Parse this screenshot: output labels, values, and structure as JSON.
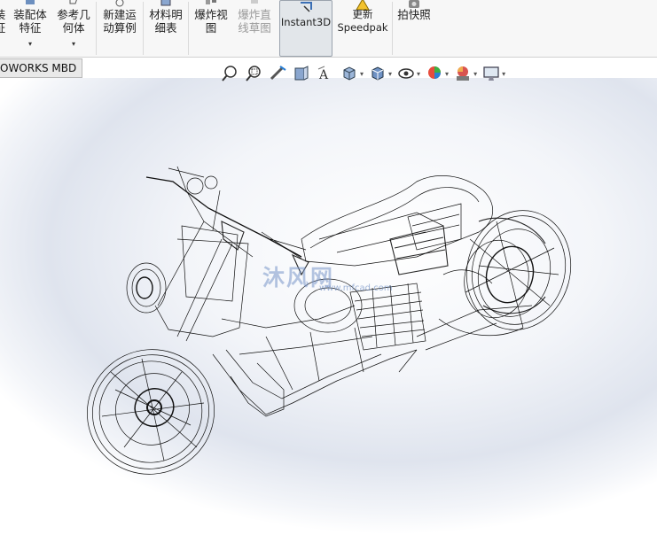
{
  "ribbon": {
    "buttons": [
      {
        "label": "装配体\n特征",
        "disabled": false,
        "icon": "assembly-features-icon"
      },
      {
        "label": "参考几\n何体",
        "disabled": false,
        "icon": "reference-geometry-icon"
      },
      {
        "label": "新建运\n动算例",
        "disabled": false,
        "icon": "new-motion-study-icon"
      },
      {
        "label": "材料明\n细表",
        "disabled": false,
        "icon": "bill-of-materials-icon"
      },
      {
        "label": "爆炸视\n图",
        "disabled": false,
        "icon": "exploded-view-icon"
      },
      {
        "label": "爆炸直\n线草图",
        "disabled": true,
        "icon": "explode-line-sketch-icon"
      },
      {
        "label": "Instant3D",
        "disabled": false,
        "active": true,
        "icon": "instant3d-icon"
      },
      {
        "label": "更新\nSpeedpak",
        "disabled": false,
        "icon": "update-speedpak-icon"
      },
      {
        "label": "拍快照",
        "disabled": false,
        "icon": "take-snapshot-icon"
      }
    ]
  },
  "tab": {
    "label": "OWORKS MBD"
  },
  "heads_up_toolbar": [
    "zoom-to-fit-icon",
    "zoom-to-area-icon",
    "previous-view-icon",
    "section-view-icon",
    "dynamic-annotation-views-icon",
    "view-orientation-icon",
    "display-style-icon",
    "hide-show-items-icon",
    "edit-appearance-icon",
    "apply-scene-icon",
    "view-settings-icon"
  ],
  "watermark": {
    "text": "沐风网",
    "url": "www.mfcad.com"
  },
  "colors": {
    "ribbon_bg": "#f7f7f7",
    "viewport_center": "#ffffff",
    "viewport_edge": "#dfe4ee",
    "wire": "#111111"
  }
}
